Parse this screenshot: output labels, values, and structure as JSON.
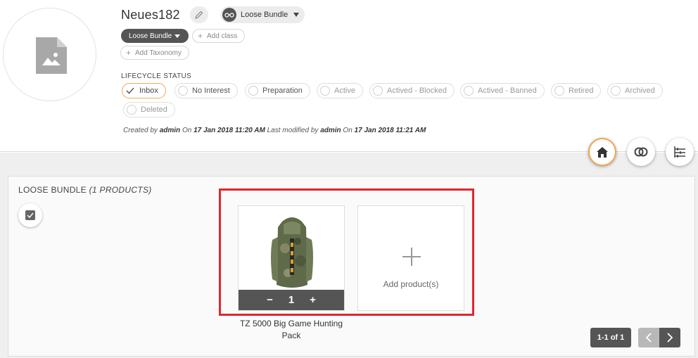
{
  "header": {
    "title": "Neues182",
    "bundle_type": "Loose Bundle",
    "class_tag": "Loose Bundle",
    "add_class_label": "Add class",
    "add_taxonomy_label": "Add Taxonomy",
    "lifecycle_label": "LIFECYCLE STATUS",
    "statuses": [
      {
        "label": "Inbox",
        "selected": true
      },
      {
        "label": "No Interest",
        "selected": false
      },
      {
        "label": "Preparation",
        "selected": false
      },
      {
        "label": "Active",
        "selected": false
      },
      {
        "label": "Actived - Blocked",
        "selected": false
      },
      {
        "label": "Actived - Banned",
        "selected": false
      },
      {
        "label": "Retired",
        "selected": false
      },
      {
        "label": "Archived",
        "selected": false
      },
      {
        "label": "Deleted",
        "selected": false
      }
    ],
    "meta": {
      "created_by_label": "Created by",
      "created_by": "admin",
      "on_label": "On",
      "created_on": "17 Jan 2018 11:20 AM",
      "modified_by_label": "Last modified by",
      "modified_by": "admin",
      "on_label_2": "On",
      "modified_on": "17 Jan 2018 11:21 AM"
    },
    "view_icons": [
      "home-icon",
      "link-rings-icon",
      "hierarchy-icon"
    ]
  },
  "panel": {
    "title": "LOOSE BUNDLE",
    "count_label": "(1 PRODUCTS)",
    "products": [
      {
        "name": "TZ 5000 Big Game Hunting Pack",
        "quantity": "1",
        "minus": "−",
        "plus": "+"
      }
    ],
    "add_label": "Add product(s)",
    "pager": {
      "count": "1-1 of 1"
    }
  },
  "colors": {
    "accent": "#f0a656",
    "dark": "#555555",
    "highlight": "#e0262e"
  }
}
